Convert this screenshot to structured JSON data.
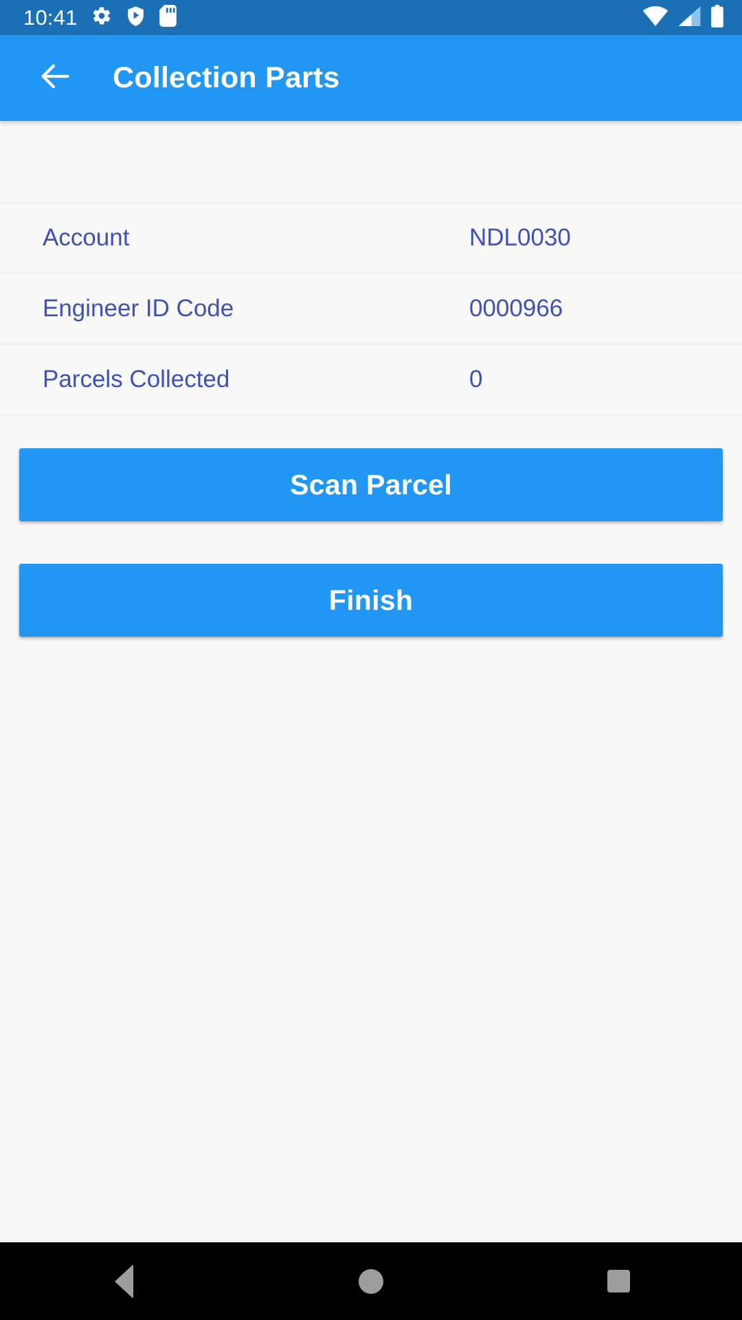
{
  "status_bar": {
    "time": "10:41",
    "left_icons": [
      {
        "name": "gear-icon"
      },
      {
        "name": "shield-play-icon"
      },
      {
        "name": "sd-card-icon"
      }
    ],
    "right_icons": [
      {
        "name": "wifi-icon"
      },
      {
        "name": "cellular-signal-icon"
      },
      {
        "name": "battery-icon"
      }
    ],
    "background_color": "#1b6fb5"
  },
  "app_bar": {
    "title": "Collection Parts",
    "back_icon": "arrow-left-icon",
    "background_color": "#2196f3",
    "text_color": "#ffffff"
  },
  "details": {
    "rows": [
      {
        "label": "Account",
        "value": "NDL0030"
      },
      {
        "label": "Engineer ID Code",
        "value": "0000966"
      },
      {
        "label": "Parcels Collected",
        "value": "0"
      }
    ],
    "text_color": "#3f51b5",
    "divider_color": "#e4e4e4"
  },
  "actions": {
    "scan_label": "Scan Parcel",
    "finish_label": "Finish",
    "button_color": "#2196f3",
    "button_text_color": "#ffffff"
  },
  "nav_bar": {
    "back_icon": "triangle-back-icon",
    "home_icon": "circle-home-icon",
    "recents_icon": "square-recents-icon",
    "background_color": "#000000",
    "icon_color": "#9e9e9e"
  }
}
